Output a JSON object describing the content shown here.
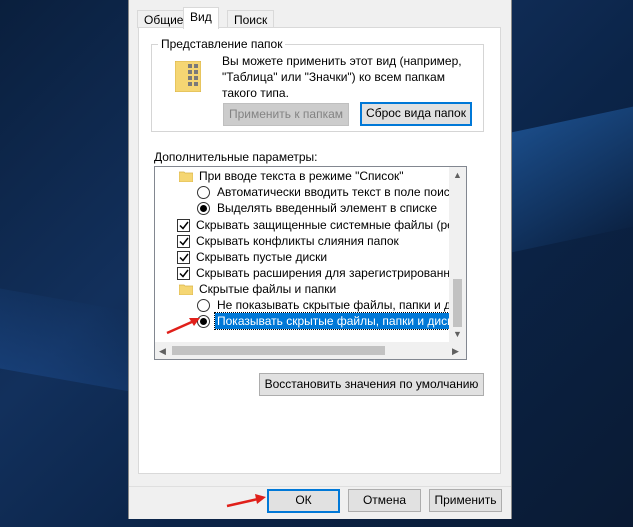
{
  "tabs": [
    {
      "label": "Общие"
    },
    {
      "label": "Вид"
    },
    {
      "label": "Поиск"
    }
  ],
  "folder_view": {
    "title": "Представление папок",
    "description": "Вы можете применить этот вид (например, \"Таблица\" или \"Значки\") ко всем папкам такого типа.",
    "apply_button": "Применить к папкам",
    "reset_button": "Сброс вида папок"
  },
  "advanced": {
    "label": "Дополнительные параметры:",
    "items": [
      {
        "type": "folder",
        "label": "При вводе текста в режиме \"Список\""
      },
      {
        "type": "radio",
        "checked": false,
        "label": "Автоматически вводить текст в поле поиска"
      },
      {
        "type": "radio",
        "checked": true,
        "label": "Выделять введенный элемент в списке"
      },
      {
        "type": "checkbox",
        "checked": true,
        "label": "Скрывать защищенные системные файлы (рекомен"
      },
      {
        "type": "checkbox",
        "checked": true,
        "label": "Скрывать конфликты слияния папок"
      },
      {
        "type": "checkbox",
        "checked": true,
        "label": "Скрывать пустые диски"
      },
      {
        "type": "checkbox",
        "checked": true,
        "label": "Скрывать расширения для зарегистрированных типо"
      },
      {
        "type": "folder",
        "label": "Скрытые файлы и папки"
      },
      {
        "type": "radio",
        "checked": false,
        "label": "Не показывать скрытые файлы, папки и диски"
      },
      {
        "type": "radio",
        "checked": true,
        "selected": true,
        "label": "Показывать скрытые файлы, папки и диски"
      }
    ]
  },
  "restore_button": "Восстановить значения по умолчанию",
  "footer": {
    "ok": "ОК",
    "cancel": "Отмена",
    "apply": "Применить"
  },
  "colors": {
    "selection": "#0078d7",
    "annotation_arrow": "#e0201a",
    "folder": "#f5d673"
  }
}
